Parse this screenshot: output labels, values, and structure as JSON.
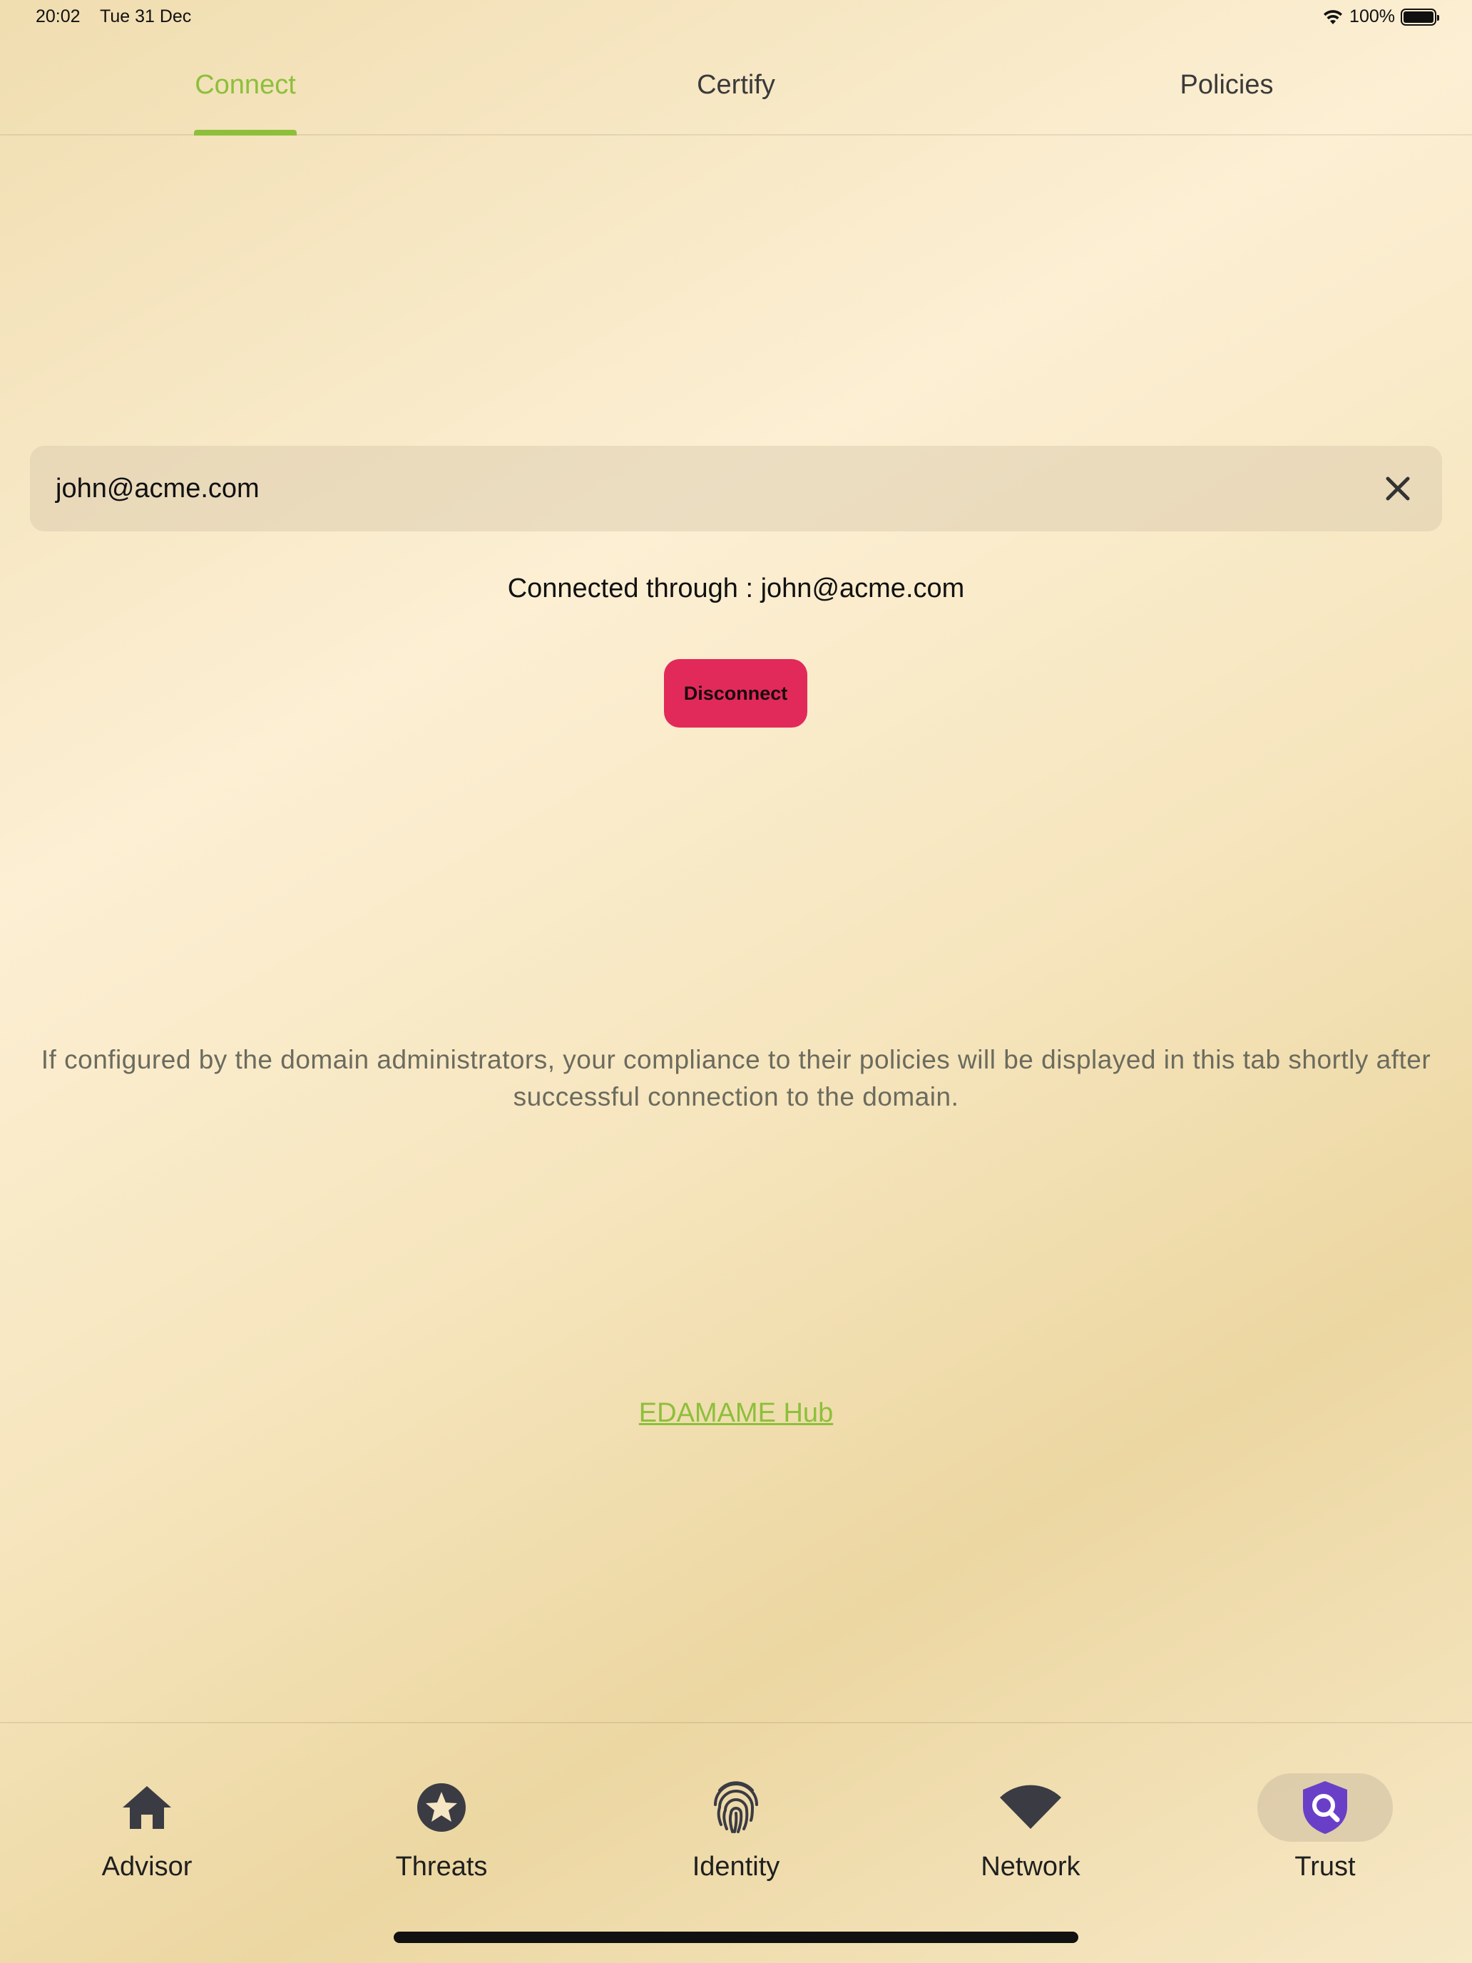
{
  "status_bar": {
    "time": "20:02",
    "date": "Tue 31 Dec",
    "battery": "100%"
  },
  "tabs": [
    {
      "label": "Connect",
      "active": true
    },
    {
      "label": "Certify",
      "active": false
    },
    {
      "label": "Policies",
      "active": false
    }
  ],
  "connect": {
    "email_value": "john@acme.com",
    "connected_text": "Connected through : john@acme.com",
    "disconnect_label": "Disconnect",
    "info_text": "If configured by the domain administrators, your compliance to their policies will be displayed in this tab shortly after successful connection to the domain.",
    "hub_link": "EDAMAME Hub"
  },
  "bottom_nav": [
    {
      "label": "Advisor",
      "icon": "home-icon",
      "active": false
    },
    {
      "label": "Threats",
      "icon": "star-badge-icon",
      "active": false
    },
    {
      "label": "Identity",
      "icon": "fingerprint-icon",
      "active": false
    },
    {
      "label": "Network",
      "icon": "wifi-icon",
      "active": false
    },
    {
      "label": "Trust",
      "icon": "shield-search-icon",
      "active": true
    }
  ],
  "colors": {
    "accent_green": "#8dbf3b",
    "disconnect_red": "#e22a5a",
    "trust_purple": "#6a3fc8"
  }
}
